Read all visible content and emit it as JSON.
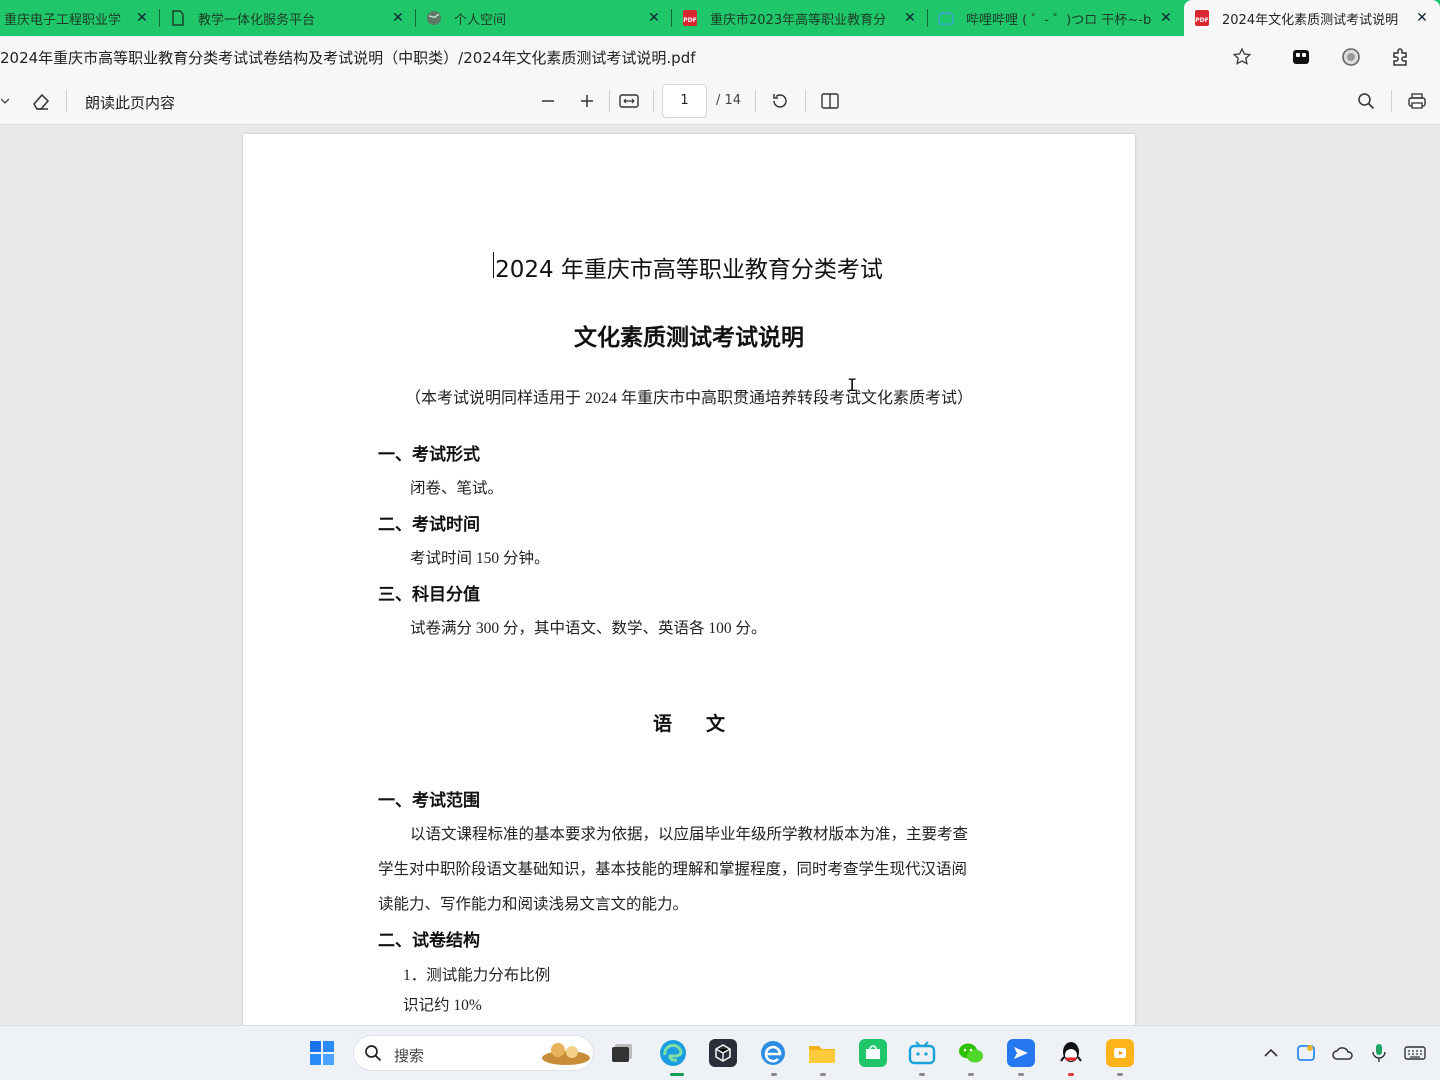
{
  "browser": {
    "tabs": [
      {
        "title": "重庆电子工程职业学",
        "icon": "school-icon",
        "active": false
      },
      {
        "title": "教学一体化服务平台",
        "icon": "page-icon",
        "active": false
      },
      {
        "title": "个人空间",
        "icon": "globe-icon",
        "active": false
      },
      {
        "title": "重庆市2023年高等职业教育分",
        "icon": "pdf-icon",
        "active": false
      },
      {
        "title": "哔哩哔哩 ( ゜- ゜)つロ 干杯~-b",
        "icon": "bilibili-icon",
        "active": false
      },
      {
        "title": "2024年文化素质测试考试说明",
        "icon": "pdf-icon",
        "active": true
      }
    ],
    "address": "2024年重庆市高等职业教育分类考试试卷结构及考试说明（中职类）/2024年文化素质测试考试说明.pdf",
    "colors": {
      "tab_strip": "#1fc76a",
      "chrome": "#f7f7f7"
    }
  },
  "pdf_toolbar": {
    "read_aloud": "朗读此页内容",
    "current_page": "1",
    "total_pages": "/ 14"
  },
  "document": {
    "title_line1": "2024 年重庆市高等职业教育分类考试",
    "title_line2": "文化素质测试考试说明",
    "note": "（本考试说明同样适用于 2024 年重庆市中高职贯通培养转段考试文化素质考试）",
    "sections": [
      {
        "heading": "一、考试形式",
        "body": "闭卷、笔试。"
      },
      {
        "heading": "二、考试时间",
        "body": "考试时间 150 分钟。"
      },
      {
        "heading": "三、科目分值",
        "body": "试卷满分 300 分，其中语文、数学、英语各 100 分。"
      }
    ],
    "subject_title": "语文",
    "subject_sections": {
      "scope_heading": "一、考试范围",
      "scope_lines": [
        "以语文课程标准的基本要求为依据，以应届毕业年级所学教材版本为准，主要考查",
        "学生对中职阶段语文基础知识，基本技能的理解和掌握程度，同时考查学生现代汉语阅",
        "读能力、写作能力和阅读浅易文言文的能力。"
      ],
      "structure_heading": "二、试卷结构",
      "item1": "1．测试能力分布比例",
      "item1_detail": "识记约 10%"
    }
  },
  "taskbar": {
    "search_placeholder": "搜索"
  }
}
